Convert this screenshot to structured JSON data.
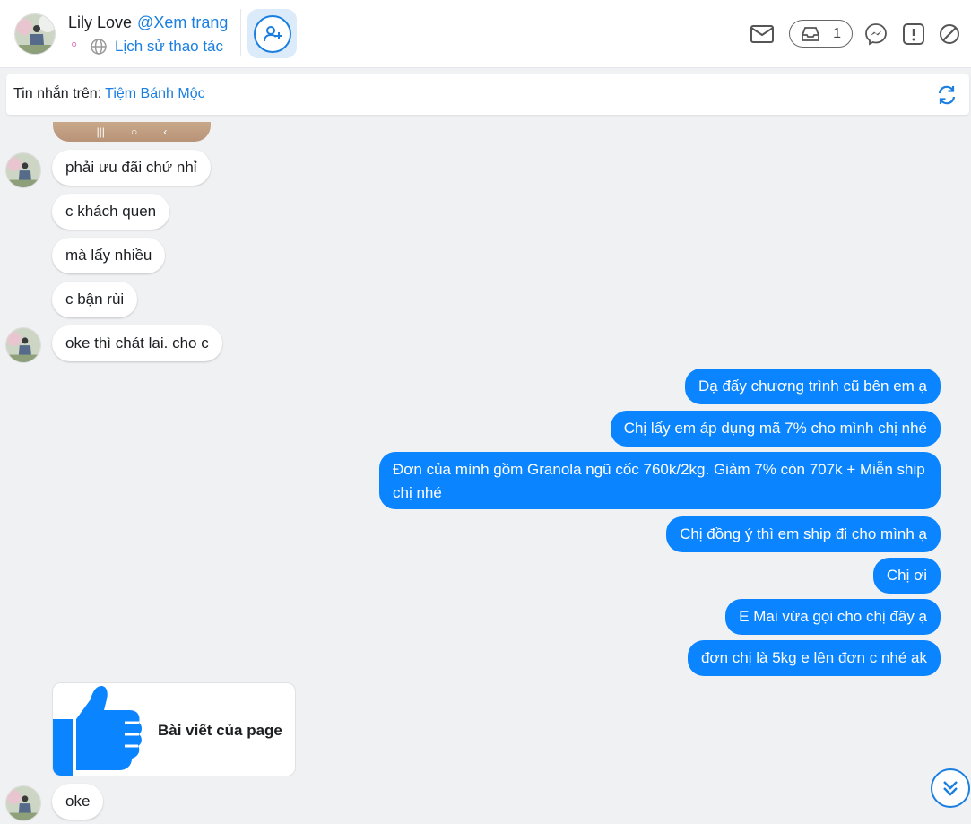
{
  "header": {
    "name": "Lily Love",
    "view_page_link": "@Xem trang",
    "gender_symbol": "♀",
    "history_link": "Lịch sử thao tác",
    "inbox_count": "1"
  },
  "infobar": {
    "prefix": "Tin nhắn trên:",
    "page_name": "Tiệm Bánh Mộc"
  },
  "messages_in": [
    "phải ưu đãi chứ nhỉ",
    "c khách quen",
    "mà lấy nhiều",
    "c bận rùi",
    "oke thì chát lai. cho c"
  ],
  "messages_out": [
    "Dạ đấy chương trình cũ bên em ạ",
    "Chị lấy em áp dụng mã 7% cho mình chị nhé",
    "Đơn của mình gồm Granola ngũ cốc 760k/2kg. Giảm 7% còn 707k + Miễn ship chị nhé",
    "Chị đồng ý thì em ship đi cho mình ạ",
    "Chị ơi",
    "E Mai vừa gọi cho chị đây ạ",
    "đơn chị là 5kg e lên đơn c nhé ak"
  ],
  "post_card": {
    "title": "Bài viết của page"
  },
  "last_message": "oke",
  "colors": {
    "accent": "#1a7fe0",
    "outgoing_bubble": "#0a84ff",
    "background": "#f0f1f3"
  }
}
